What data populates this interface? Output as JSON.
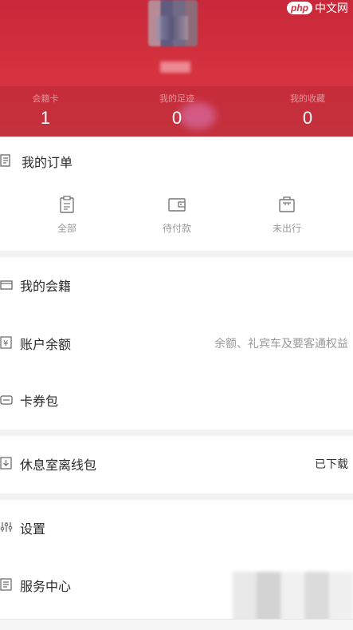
{
  "watermark": {
    "brand_badge": "php",
    "brand_text": "中文网"
  },
  "header": {
    "stats": [
      {
        "label": "会籍卡",
        "value": "1"
      },
      {
        "label": "我的足迹",
        "value": "0"
      },
      {
        "label": "我的收藏",
        "value": "0"
      }
    ]
  },
  "orders": {
    "title": "我的订单",
    "items": [
      {
        "label": "全部",
        "icon": "clipboard-icon"
      },
      {
        "label": "待付款",
        "icon": "wallet-icon"
      },
      {
        "label": "未出行",
        "icon": "suitcase-icon"
      }
    ]
  },
  "menu_group_1": [
    {
      "label": "我的会籍",
      "right": "",
      "icon": "card-icon"
    },
    {
      "label": "账户余额",
      "right": "余额、礼宾车及要客通权益",
      "icon": "yen-icon"
    },
    {
      "label": "卡券包",
      "right": "",
      "icon": "coupon-icon"
    }
  ],
  "menu_group_2": [
    {
      "label": "休息室离线包",
      "right": "已下载",
      "icon": "download-icon"
    }
  ],
  "menu_group_3": [
    {
      "label": "设置",
      "right": "",
      "icon": "settings-icon"
    },
    {
      "label": "服务中心",
      "right": "",
      "icon": "service-icon"
    }
  ],
  "colors": {
    "header_red": "#d0333f",
    "divider": "#f2f2f4"
  }
}
